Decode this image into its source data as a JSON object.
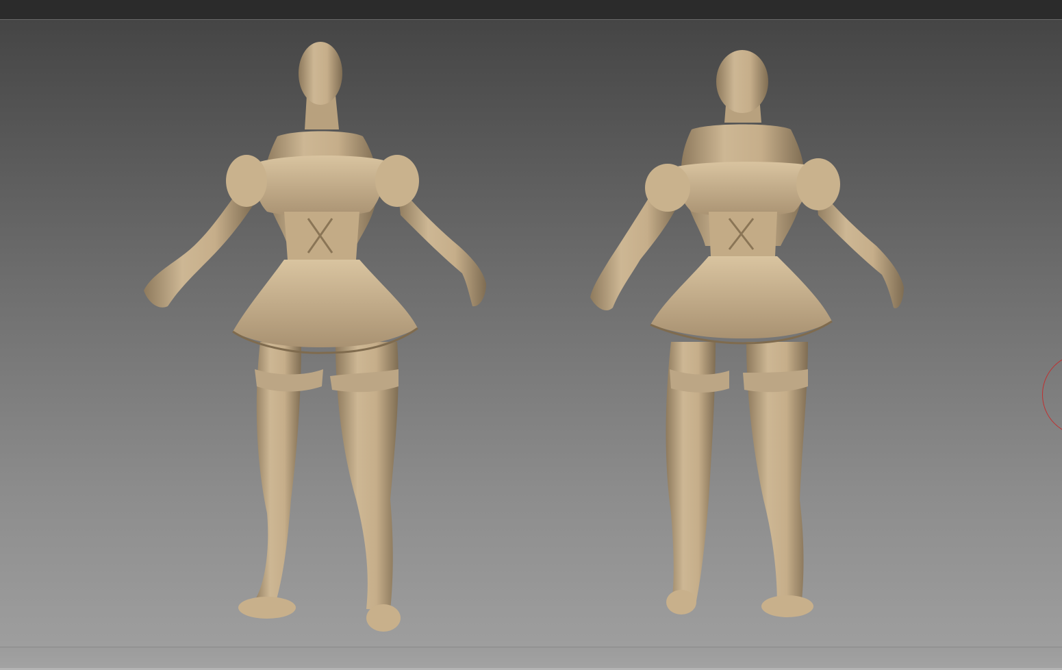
{
  "canvas": {
    "background_top": "#454545",
    "background_bottom": "#9e9e9e",
    "clay_color": "#c9b28d",
    "brush_ring_color": "#c03030"
  },
  "views": [
    {
      "name": "front-view"
    },
    {
      "name": "back-view"
    }
  ]
}
